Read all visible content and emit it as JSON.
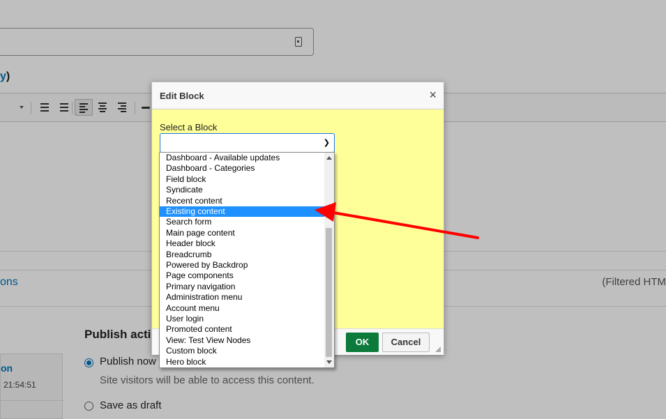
{
  "page": {
    "body_label_link": "y",
    "body_label_paren": ")",
    "format_link": "ons",
    "format_filter": "(Filtered HTM",
    "sidebar_title": "on",
    "sidebar_time": "21:54:51",
    "publish_title": "Publish actic",
    "publish_now_label": "Publish now",
    "publish_now_desc": "Site visitors will be able to access this content.",
    "draft_label": "Save as draft",
    "toolbar_icons": [
      "dropdown-arrow",
      "bulleted-list-icon",
      "numbered-list-icon",
      "align-left-icon",
      "align-center-icon",
      "align-right-icon",
      "link-icon"
    ]
  },
  "dialog": {
    "title": "Edit Block",
    "close_label": "×",
    "select_label": "Select a Block",
    "select_value": "",
    "ok_label": "OK",
    "cancel_label": "Cancel",
    "background_color": "#ffff99"
  },
  "dropdown": {
    "options": [
      "Dashboard - Available updates",
      "Dashboard - Categories",
      "Field block",
      "Syndicate",
      "Recent content",
      "Existing content",
      "Search form",
      "Main page content",
      "Header block",
      "Breadcrumb",
      "Powered by Backdrop",
      "Page components",
      "Primary navigation",
      "Administration menu",
      "Account menu",
      "User login",
      "Promoted content",
      "View: Test View Nodes",
      "Custom block",
      "Hero block"
    ],
    "highlighted": "Existing content",
    "highlight_color": "#1e90ff"
  },
  "annotation": {
    "arrow_color": "#ff0000"
  }
}
